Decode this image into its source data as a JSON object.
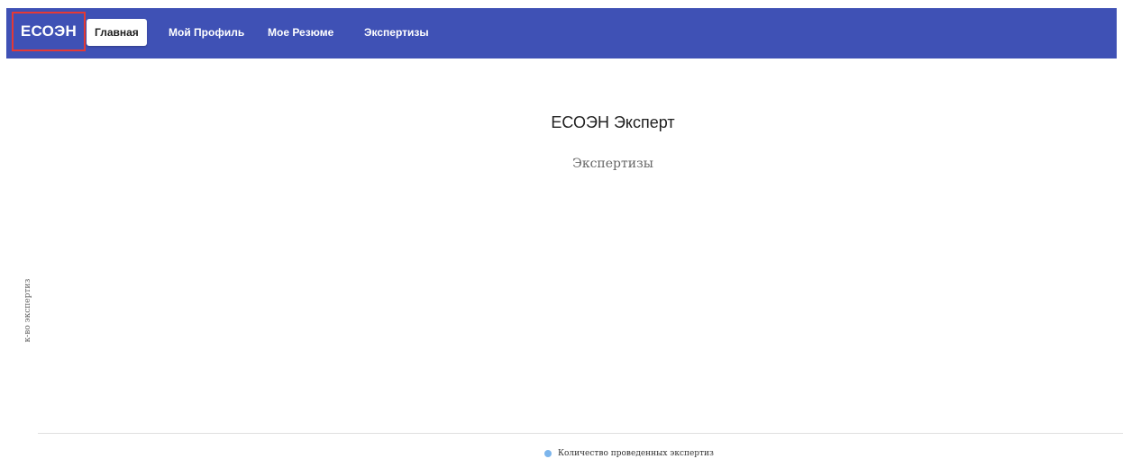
{
  "navbar": {
    "brand": "ЕСОЭН",
    "items": [
      {
        "label": "Главная",
        "active": true
      },
      {
        "label": "Мой Профиль",
        "active": false
      },
      {
        "label": "Мое Резюме",
        "active": false
      },
      {
        "label": "Экспертизы",
        "active": false
      }
    ],
    "background": "#3f51b5",
    "brand_highlight_color": "#e53935"
  },
  "chart_data": {
    "type": "line",
    "title": "ЕСОЭН Эксперт",
    "subtitle": "Экспертизы",
    "ylabel": "к-во экспертиз",
    "xlabel": "",
    "series": [
      {
        "name": "Количество проведенных экспертиз",
        "values": [],
        "color": "#7cb5ec"
      }
    ],
    "legend_position": "bottom-center",
    "grid": false
  }
}
